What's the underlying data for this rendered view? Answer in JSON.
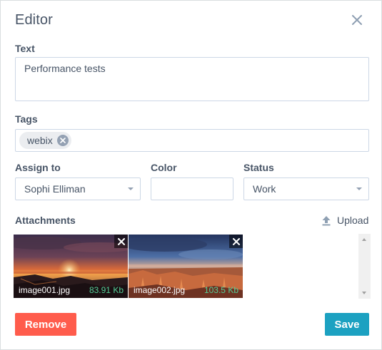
{
  "dialog": {
    "title": "Editor",
    "close_icon": "close-icon"
  },
  "text_field": {
    "label": "Text",
    "value": "Performance tests"
  },
  "tags_field": {
    "label": "Tags",
    "tags": [
      "webix"
    ],
    "remove_icon": "remove-tag-icon"
  },
  "assign_to": {
    "label": "Assign to",
    "value": "Sophi Elliman"
  },
  "color": {
    "label": "Color",
    "value": ""
  },
  "status": {
    "label": "Status",
    "value": "Work"
  },
  "attachments": {
    "label": "Attachments",
    "upload_label": "Upload",
    "upload_icon": "upload-icon",
    "files": [
      {
        "name": "image001.jpg",
        "size": "83.91 Kb",
        "picture": "sunset-over-rocky-coast"
      },
      {
        "name": "image002.jpg",
        "size": "103.5 Kb",
        "picture": "red-canyon-hoodoos"
      }
    ]
  },
  "footer": {
    "remove_label": "Remove",
    "save_label": "Save"
  },
  "colors": {
    "remove_button": "#ff5c4c",
    "save_button": "#1ca1c1",
    "file_size": "#55cd97",
    "text": "#475466",
    "border": "#ccd7e6"
  }
}
